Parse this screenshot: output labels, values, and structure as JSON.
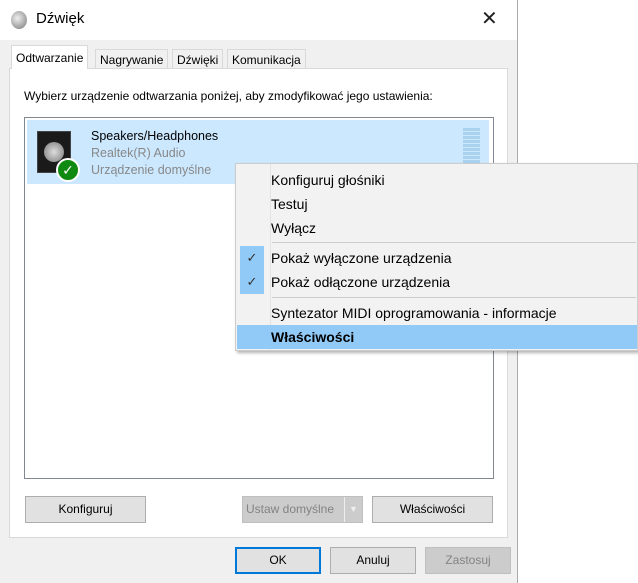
{
  "window": {
    "title": "Dźwięk",
    "close_icon": "close-icon"
  },
  "tabs": [
    {
      "label": "Odtwarzanie",
      "active": true
    },
    {
      "label": "Nagrywanie"
    },
    {
      "label": "Dźwięki"
    },
    {
      "label": "Komunikacja"
    }
  ],
  "instruction": "Wybierz urządzenie odtwarzania poniżej, aby zmodyfikować jego ustawienia:",
  "devices": [
    {
      "name": "Speakers/Headphones",
      "driver": "Realtek(R) Audio",
      "status": "Urządzenie domyślne",
      "selected": true,
      "default": true
    }
  ],
  "panel_buttons": {
    "configure": "Konfiguruj",
    "set_default": "Ustaw domyślne",
    "properties": "Właściwości"
  },
  "dialog_buttons": {
    "ok": "OK",
    "cancel": "Anuluj",
    "apply": "Zastosuj"
  },
  "context_menu": {
    "items": [
      {
        "label": "Konfiguruj głośniki"
      },
      {
        "label": "Testuj"
      },
      {
        "label": "Wyłącz"
      },
      {
        "label": "Pokaż wyłączone urządzenia",
        "checked": true
      },
      {
        "label": "Pokaż odłączone urządzenia",
        "checked": true
      },
      {
        "label": "Syntezator MIDI oprogramowania - informacje"
      },
      {
        "label": "Właściwości",
        "highlighted": true
      }
    ],
    "check_mark": "✓"
  },
  "colors": {
    "selection": "#cce8ff",
    "menu_highlight": "#91c9f7",
    "focus": "#0078d7"
  }
}
